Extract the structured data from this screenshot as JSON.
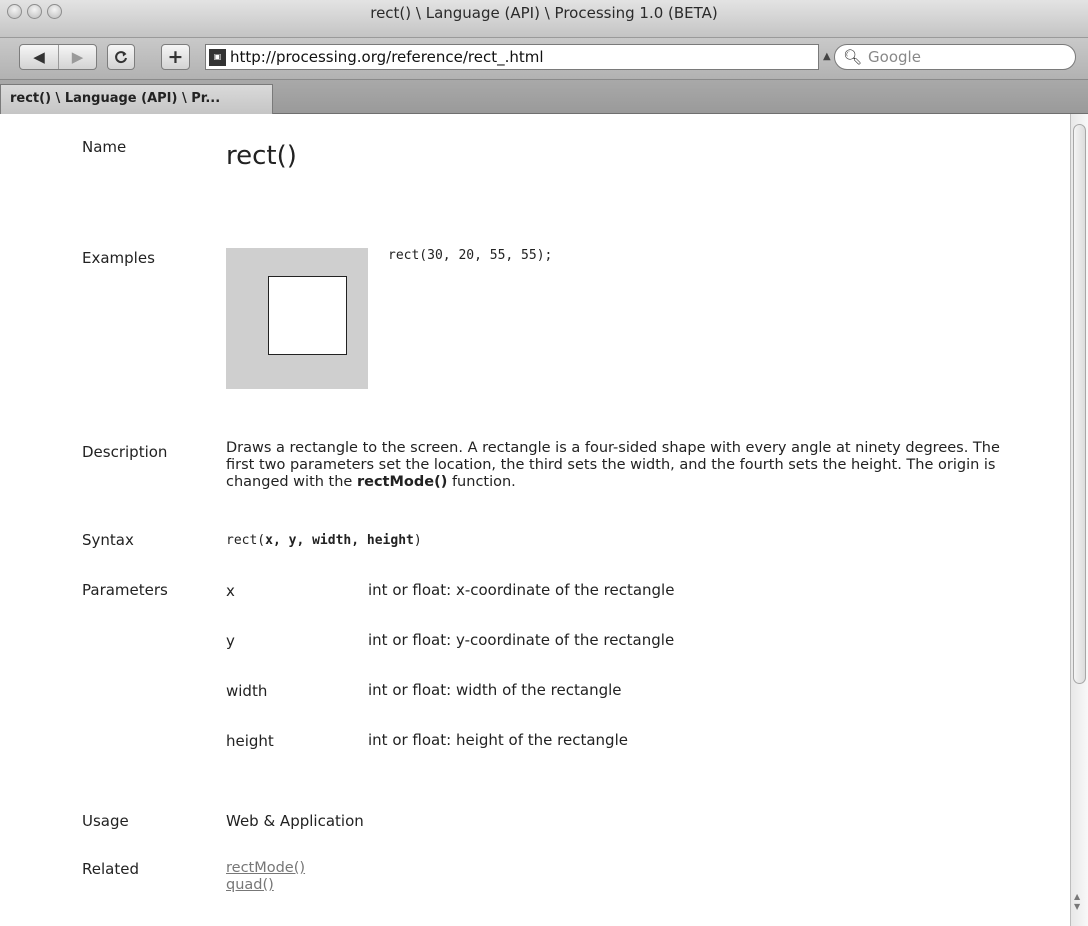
{
  "window": {
    "title": "rect() \\ Language (API) \\ Processing 1.0 (BETA)"
  },
  "toolbar": {
    "back_glyph": "◀",
    "forward_glyph": "▶",
    "reload_glyph": "ℭ",
    "add_glyph": "+",
    "url": "http://processing.org/reference/rect_.html",
    "search_placeholder": "Google"
  },
  "tab": {
    "label": "rect() \\ Language (API) \\ Pr..."
  },
  "page": {
    "name_label": "Name",
    "name_value": "rect()",
    "examples_label": "Examples",
    "example_code": "rect(30, 20, 55, 55);",
    "description_label": "Description",
    "description_text": "Draws a rectangle to the screen. A rectangle is a four-sided shape with every angle at ninety degrees. The first two parameters set the location, the third sets the width, and the fourth sets the height. The origin is changed with the",
    "description_link": "rectMode()",
    "description_tail": "function.",
    "syntax_label": "Syntax",
    "syntax_fn": "rect(",
    "syntax_args": "x, y, width, height",
    "syntax_close": ")",
    "parameters_label": "Parameters",
    "parameters": [
      {
        "name": "x",
        "desc": "int or float: x-coordinate of the rectangle"
      },
      {
        "name": "y",
        "desc": "int or float: y-coordinate of the rectangle"
      },
      {
        "name": "width",
        "desc": "int or float: width of the rectangle"
      },
      {
        "name": "height",
        "desc": "int or float: height of the rectangle"
      }
    ],
    "usage_label": "Usage",
    "usage_value": "Web & Application",
    "related_label": "Related",
    "related": [
      "rectMode()",
      "quad()"
    ]
  }
}
